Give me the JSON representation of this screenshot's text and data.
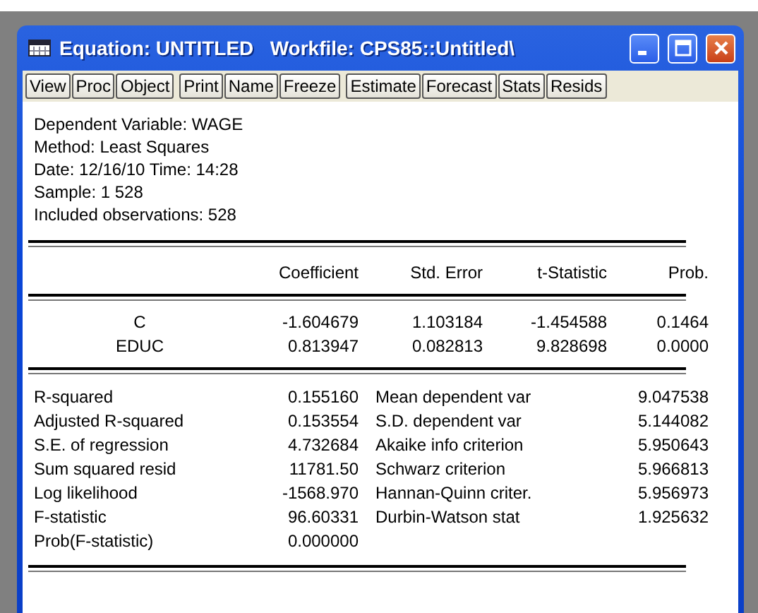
{
  "window": {
    "title": "Equation: UNTITLED   Workfile: CPS85::Untitled\\"
  },
  "toolbar": {
    "groups": [
      [
        "View",
        "Proc",
        "Object"
      ],
      [
        "Print",
        "Name",
        "Freeze"
      ],
      [
        "Estimate",
        "Forecast",
        "Stats",
        "Resids"
      ]
    ]
  },
  "header": [
    "Dependent Variable: WAGE",
    "Method: Least Squares",
    "Date: 12/16/10   Time: 14:28",
    "Sample: 1 528",
    "Included observations: 528"
  ],
  "table": {
    "columns": [
      "Coefficient",
      "Std. Error",
      "t-Statistic",
      "Prob."
    ],
    "rows": [
      {
        "variable": "C",
        "values": [
          "-1.604679",
          "1.103184",
          "-1.454588",
          "0.1464"
        ]
      },
      {
        "variable": "EDUC",
        "values": [
          "0.813947",
          "0.082813",
          "9.828698",
          "0.0000"
        ]
      }
    ]
  },
  "statistics": [
    {
      "label": "R-squared",
      "value": "0.155160",
      "label_2": "Mean dependent var",
      "value_2": "9.047538"
    },
    {
      "label": "Adjusted R-squared",
      "value": "0.153554",
      "label_2": "S.D. dependent var",
      "value_2": "5.144082"
    },
    {
      "label": "S.E. of regression",
      "value": "4.732684",
      "label_2": "Akaike info criterion",
      "value_2": "5.950643"
    },
    {
      "label": "Sum squared resid",
      "value": "11781.50",
      "label_2": "Schwarz criterion",
      "value_2": "5.966813"
    },
    {
      "label": "Log likelihood",
      "value": "-1568.970",
      "label_2": "Hannan-Quinn criter.",
      "value_2": "5.956973"
    },
    {
      "label": "F-statistic",
      "value": "96.60331",
      "label_2": "Durbin-Watson stat",
      "value_2": "1.925632"
    },
    {
      "label": "Prob(F-statistic)",
      "value": "0.000000"
    }
  ]
}
